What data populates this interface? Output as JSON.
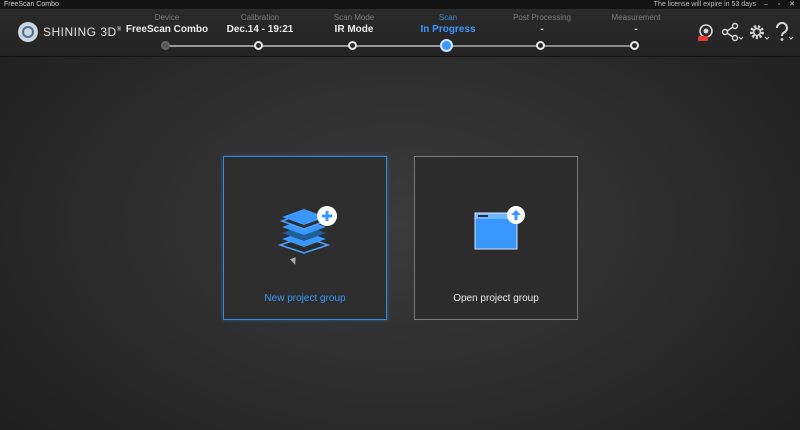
{
  "window": {
    "title": "FreeScan Combo",
    "license_notice": "The license will expire in 53 days",
    "controls": [
      "–",
      "▫",
      "✕"
    ]
  },
  "brand": {
    "name": "SHINING 3D",
    "trademark": "®"
  },
  "workflow": {
    "steps": [
      {
        "category": "Device",
        "value": "FreeScan Combo",
        "state": "completed"
      },
      {
        "category": "Calibration",
        "value": "Dec.14 - 19:21",
        "state": "done"
      },
      {
        "category": "Scan Mode",
        "value": "IR Mode",
        "state": "done"
      },
      {
        "category": "Scan",
        "value": "In Progress",
        "state": "active"
      },
      {
        "category": "Post Processing",
        "value": "-",
        "state": "pending"
      },
      {
        "category": "Measurement",
        "value": "-",
        "state": "pending"
      }
    ]
  },
  "toolbar": {
    "icons": [
      "record-icon",
      "share-icon",
      "settings-icon",
      "help-icon"
    ],
    "accent": "#3a97ff",
    "alert": "#e53935"
  },
  "cards": {
    "new_project": {
      "label": "New project group"
    },
    "open_project": {
      "label": "Open project group"
    }
  }
}
